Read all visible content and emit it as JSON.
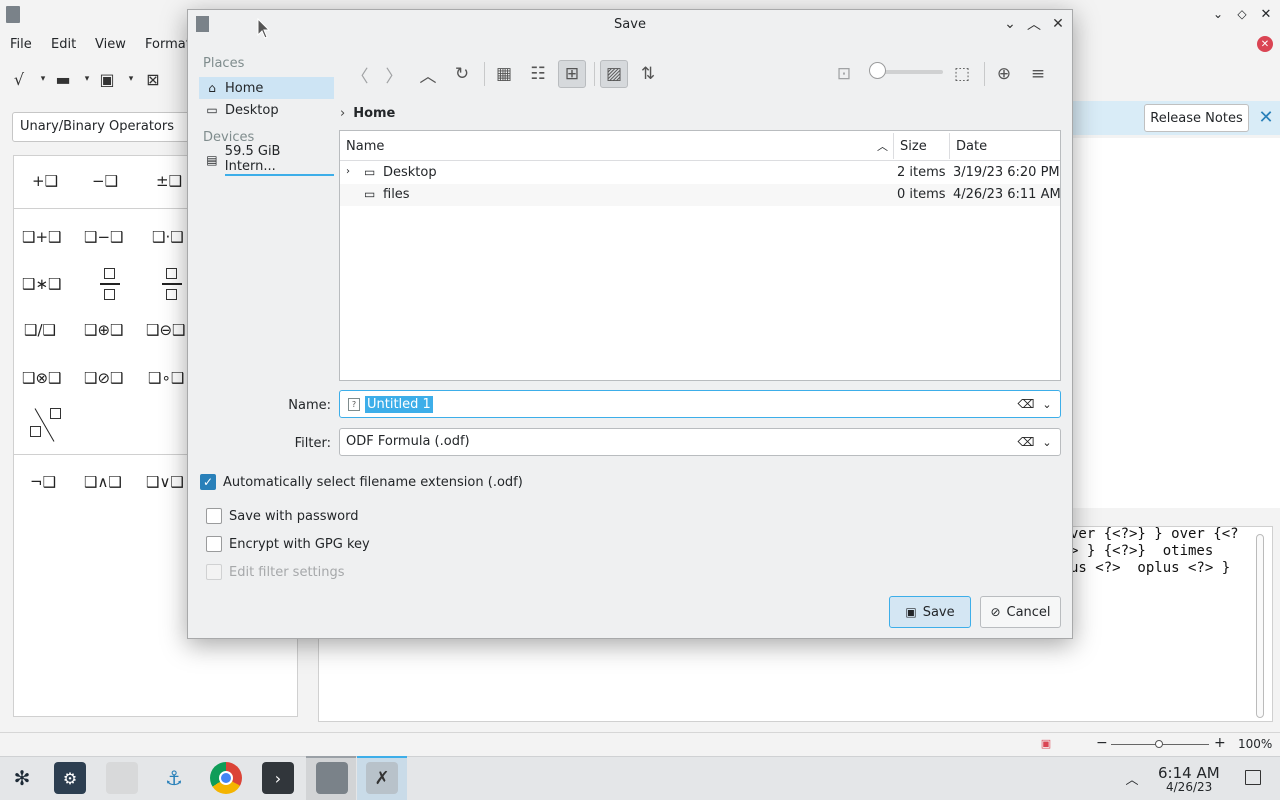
{
  "background_app": {
    "menu": [
      "File",
      "Edit",
      "View",
      "Format"
    ],
    "operators_dropdown": "Unary/Binary Operators",
    "release_notes": "Release Notes",
    "elements": {
      "row1": [
        "+❑",
        "−❑",
        "±❑"
      ],
      "row2": [
        "❑+❑",
        "❑−❑",
        "❑·❑"
      ],
      "row3": [
        "❑∗❑"
      ],
      "row4": [
        "❑/❑",
        "❑⊕❑",
        "❑⊖❑"
      ],
      "row5": [
        "❑⊗❑",
        "❑⊘❑",
        "❑∘❑"
      ],
      "row7": [
        "¬❑",
        "❑∧❑",
        "❑∨❑"
      ]
    },
    "formula_text": [
      "ver {<?>} } over {<?",
      "> } {<?>}  otimes",
      "us <?>  oplus <?> }"
    ],
    "zoom": "100%"
  },
  "taskbar": {
    "time": "6:14 AM",
    "date": "4/26/23"
  },
  "dialog": {
    "title": "Save",
    "places_header": "Places",
    "places": [
      {
        "label": "Home",
        "icon": "home-icon"
      },
      {
        "label": "Desktop",
        "icon": "desktop-icon"
      }
    ],
    "devices_header": "Devices",
    "devices": [
      {
        "label": "59.5 GiB Intern...",
        "icon": "drive-icon"
      }
    ],
    "breadcrumb": "Home",
    "columns": {
      "name": "Name",
      "size": "Size",
      "date": "Date"
    },
    "files": [
      {
        "name": "Desktop",
        "size": "2 items",
        "date": "3/19/23 6:20 PM",
        "icon": "desktop-icon"
      },
      {
        "name": "files",
        "size": "0 items",
        "date": "4/26/23 6:11 AM",
        "icon": "folder-icon"
      }
    ],
    "name_label": "Name:",
    "name_value": "Untitled 1",
    "filter_label": "Filter:",
    "filter_value": "ODF Formula (.odf)",
    "auto_ext": {
      "label": "Automatically select filename extension (.odf)",
      "checked": true
    },
    "save_with_password": {
      "label": "Save with password",
      "checked": false
    },
    "encrypt_gpg": {
      "label": "Encrypt with GPG key",
      "checked": false
    },
    "edit_filter": {
      "label": "Edit filter settings",
      "checked": false
    },
    "save_button": "Save",
    "cancel_button": "Cancel",
    "accent_color": "#3daee9"
  }
}
